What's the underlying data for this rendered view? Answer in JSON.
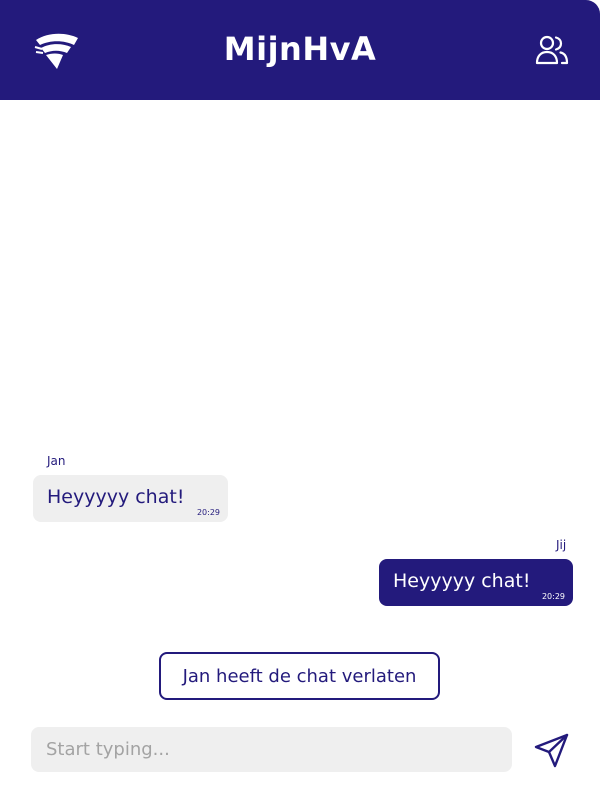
{
  "header": {
    "title": "MijnHvA",
    "logo_icon": "hva-logo-icon",
    "users_icon": "users-icon"
  },
  "messages": [
    {
      "sender": "Jan",
      "text": "Heyyyyy chat!",
      "time": "20:29",
      "direction": "incoming"
    },
    {
      "sender": "Jij",
      "text": "Heyyyyy chat!",
      "time": "20:29",
      "direction": "outgoing"
    }
  ],
  "system_notice": "Jan heeft de chat verlaten",
  "composer": {
    "placeholder": "Start typing...",
    "value": "",
    "send_icon": "send-icon"
  },
  "colors": {
    "brand": "#231a7c",
    "bubble_incoming": "#efefef",
    "input_bg": "#efefef",
    "placeholder": "#a3a3a3"
  }
}
